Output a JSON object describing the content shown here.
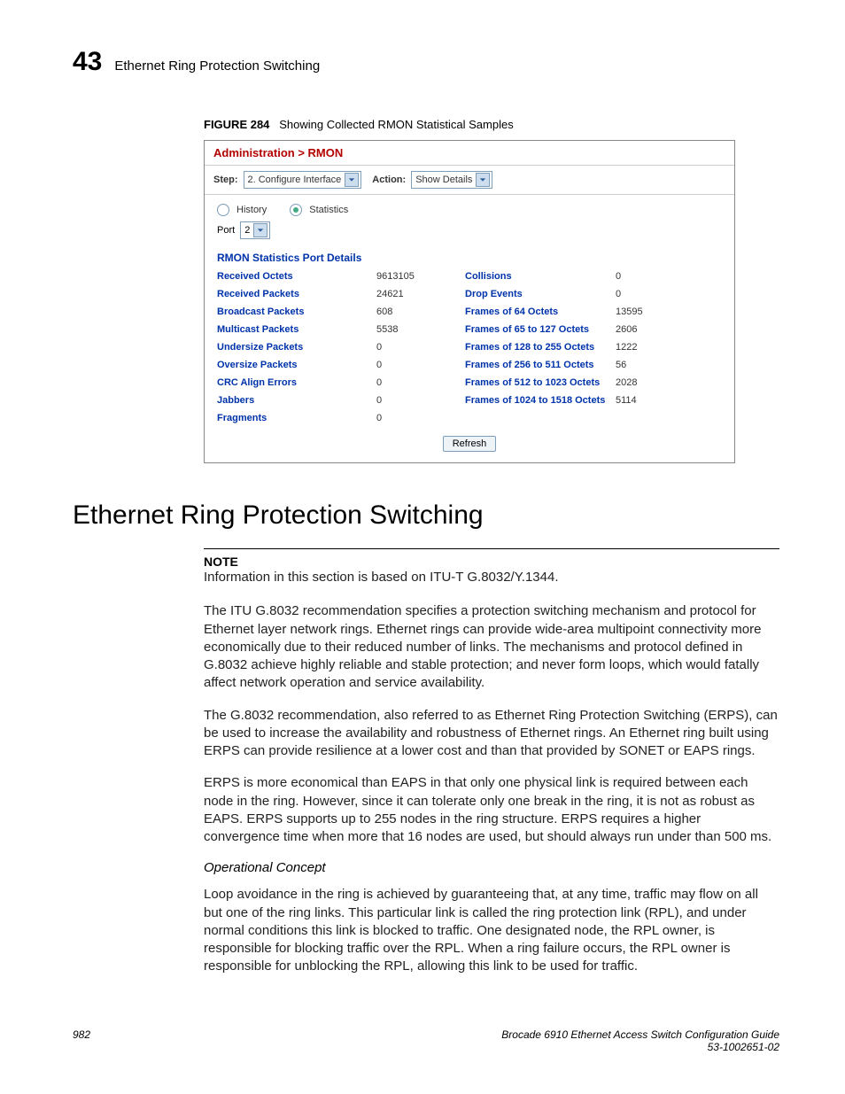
{
  "header": {
    "chapter_number": "43",
    "chapter_title": "Ethernet Ring Protection Switching"
  },
  "figure": {
    "label": "FIGURE 284",
    "caption": "Showing Collected RMON Statistical Samples"
  },
  "panel": {
    "breadcrumb": "Administration > RMON",
    "step_label": "Step:",
    "step_value": "2. Configure Interface",
    "action_label": "Action:",
    "action_value": "Show Details",
    "radio_history": "History",
    "radio_statistics": "Statistics",
    "port_label": "Port",
    "port_value": "2",
    "section_title": "RMON Statistics Port Details",
    "stats_left": [
      {
        "label": "Received Octets",
        "value": "9613105"
      },
      {
        "label": "Received Packets",
        "value": "24621"
      },
      {
        "label": "Broadcast Packets",
        "value": "608"
      },
      {
        "label": "Multicast Packets",
        "value": "5538"
      },
      {
        "label": "Undersize Packets",
        "value": "0"
      },
      {
        "label": "Oversize Packets",
        "value": "0"
      },
      {
        "label": "CRC Align Errors",
        "value": "0"
      },
      {
        "label": "Jabbers",
        "value": "0"
      },
      {
        "label": "Fragments",
        "value": "0"
      }
    ],
    "stats_right": [
      {
        "label": "Collisions",
        "value": "0"
      },
      {
        "label": "Drop Events",
        "value": "0"
      },
      {
        "label": "Frames of 64 Octets",
        "value": "13595"
      },
      {
        "label": "Frames of 65 to 127 Octets",
        "value": "2606"
      },
      {
        "label": "Frames of 128 to 255 Octets",
        "value": "1222"
      },
      {
        "label": "Frames of 256 to 511 Octets",
        "value": "56"
      },
      {
        "label": "Frames of 512 to 1023 Octets",
        "value": "2028"
      },
      {
        "label": "Frames of 1024 to 1518 Octets",
        "value": "5114"
      }
    ],
    "refresh": "Refresh"
  },
  "section": {
    "heading": "Ethernet Ring Protection Switching",
    "note_label": "NOTE",
    "note_text": "Information in this section is based on ITU-T G.8032/Y.1344.",
    "p1": "The ITU G.8032 recommendation specifies a protection switching mechanism and protocol for Ethernet layer network rings. Ethernet rings can provide wide-area multipoint connectivity more economically due to their reduced number of links. The mechanisms and protocol defined in G.8032 achieve highly reliable and stable protection; and never form loops, which would fatally affect network operation and service availability.",
    "p2": "The G.8032 recommendation, also referred to as Ethernet Ring Protection Switching (ERPS), can be used to increase the availability and robustness of Ethernet rings. An Ethernet ring built using ERPS can provide resilience at a lower cost and than that provided by SONET or EAPS rings.",
    "p3": "ERPS is more economical than EAPS in that only one physical link is required between each node in the ring. However, since it can tolerate only one break in the ring, it is not as robust as EAPS. ERPS supports up to 255 nodes in the ring structure. ERPS requires a higher convergence time when more that 16 nodes are used, but should always run under than 500 ms.",
    "subhead": "Operational Concept",
    "p4": "Loop avoidance in the ring is achieved by guaranteeing that, at any time, traffic may flow on all but one of the ring links. This particular link is called the ring protection link (RPL), and under normal conditions this link is blocked to traffic. One designated node, the RPL owner, is responsible for blocking traffic over the RPL. When a ring failure occurs, the RPL owner is responsible for unblocking the RPL, allowing this link to be used for traffic."
  },
  "footer": {
    "page": "982",
    "doc_title": "Brocade 6910 Ethernet Access Switch Configuration Guide",
    "doc_num": "53-1002651-02"
  }
}
